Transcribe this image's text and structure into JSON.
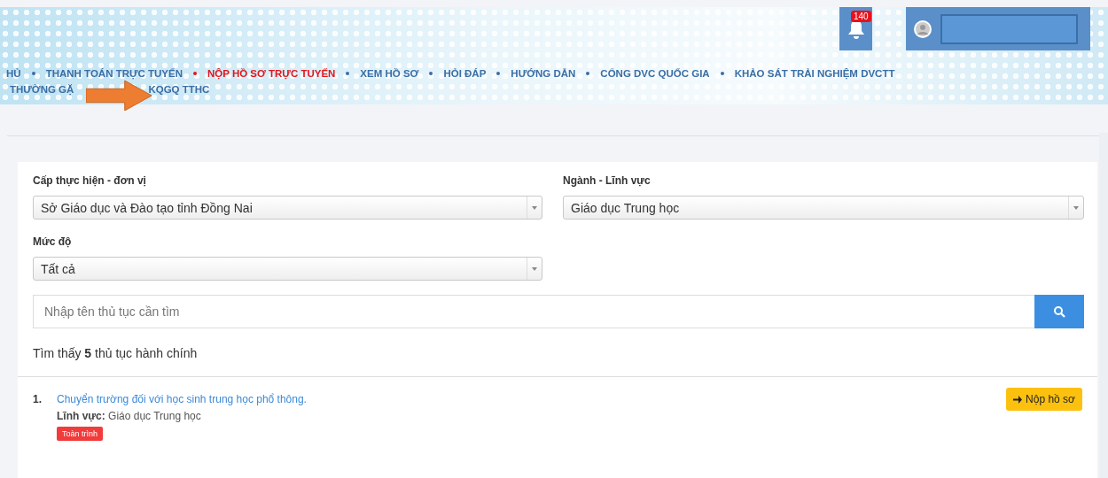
{
  "header": {
    "notifications": {
      "count": "140"
    },
    "nav_rows": [
      [
        {
          "label": "HỦ",
          "selected": false,
          "bullet": false
        },
        {
          "label": "THANH TOÁN TRỰC TUYẾN",
          "selected": false,
          "bullet": true
        },
        {
          "label": "NỘP HỒ SƠ TRỰC TUYẾN",
          "selected": true,
          "bullet": true
        },
        {
          "label": "XEM HỒ SƠ",
          "selected": false,
          "bullet": true
        },
        {
          "label": "HỎI ĐÁP",
          "selected": false,
          "bullet": true
        },
        {
          "label": "HƯỚNG DẪN",
          "selected": false,
          "bullet": true
        },
        {
          "label": "CỔNG DVC QUỐC GIA",
          "selected": false,
          "bullet": true
        },
        {
          "label": "KHẢO SÁT TRẢI NGHIỆM DVCTT",
          "selected": false,
          "bullet": true
        }
      ],
      [
        {
          "label": "THƯỜNG GẶ",
          "selected": false,
          "bullet": false
        },
        {
          "label": "KQGQ TTHC",
          "selected": false,
          "bullet": false
        }
      ]
    ]
  },
  "filters": [
    {
      "label": "Cấp thực hiện - đơn vị",
      "value": "Sở Giáo dục và Đào tạo tỉnh Đồng Nai"
    },
    {
      "label": "Ngành - Lĩnh vực",
      "value": "Giáo dục Trung học"
    },
    {
      "label": "Mức độ",
      "value": "Tất cả"
    }
  ],
  "search": {
    "placeholder": "Nhập tên thủ tục cần tìm"
  },
  "result_summary": "Tìm thấy **5** thủ tục hành chính",
  "results": [
    {
      "number": "1.",
      "title": "Chuyển trường đối với học sinh trung học phổ thông.",
      "field_label": "Lĩnh vực:",
      "field_value": "Giáo dục Trung học",
      "badge": "Toàn trình",
      "action": "Nộp hồ sơ"
    }
  ]
}
